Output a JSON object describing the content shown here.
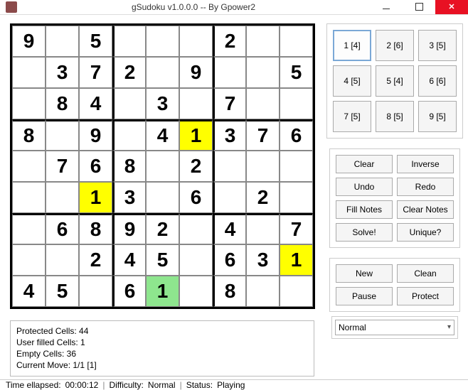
{
  "window": {
    "title": "gSudoku v1.0.0.0 -- By Gpower2"
  },
  "board": {
    "rows": [
      [
        "9",
        "",
        "5",
        "",
        "",
        "",
        "2",
        "",
        ""
      ],
      [
        "",
        "3",
        "7",
        "2",
        "",
        "9",
        "",
        "",
        "5"
      ],
      [
        "",
        "8",
        "4",
        "",
        "3",
        "",
        "7",
        "",
        ""
      ],
      [
        "8",
        "",
        "9",
        "",
        "4",
        "1",
        "3",
        "7",
        "6"
      ],
      [
        "",
        "7",
        "6",
        "8",
        "",
        "2",
        "",
        "",
        ""
      ],
      [
        "",
        "",
        "1",
        "3",
        "",
        "6",
        "",
        "2",
        ""
      ],
      [
        "",
        "6",
        "8",
        "9",
        "2",
        "",
        "4",
        "",
        "7"
      ],
      [
        "",
        "",
        "2",
        "4",
        "5",
        "",
        "6",
        "3",
        "1"
      ],
      [
        "4",
        "5",
        "",
        "6",
        "1",
        "",
        "8",
        "",
        ""
      ]
    ],
    "highlights": {
      "yellow": [
        [
          3,
          5
        ],
        [
          5,
          2
        ],
        [
          7,
          8
        ]
      ],
      "green": [
        [
          8,
          4
        ]
      ]
    }
  },
  "numpad": [
    {
      "label": "1 [4]",
      "selected": true
    },
    {
      "label": "2 [6]",
      "selected": false
    },
    {
      "label": "3 [5]",
      "selected": false
    },
    {
      "label": "4 [5]",
      "selected": false
    },
    {
      "label": "5 [4]",
      "selected": false
    },
    {
      "label": "6 [6]",
      "selected": false
    },
    {
      "label": "7 [5]",
      "selected": false
    },
    {
      "label": "8 [5]",
      "selected": false
    },
    {
      "label": "9 [5]",
      "selected": false
    }
  ],
  "actions1": [
    "Clear",
    "Inverse",
    "Undo",
    "Redo",
    "Fill Notes",
    "Clear Notes",
    "Solve!",
    "Unique?"
  ],
  "actions2": [
    "New",
    "Clean",
    "Pause",
    "Protect"
  ],
  "difficulty_select": "Normal",
  "info": {
    "protected": "Protected Cells: 44",
    "userfilled": "User filled Cells: 1",
    "empty": "Empty Cells: 36",
    "currentmove": "Current Move: 1/1 [1]"
  },
  "status": {
    "time_label": "Time ellapsed:",
    "time_value": "00:00:12",
    "diff_label": "Difficulty:",
    "diff_value": "Normal",
    "status_label": "Status:",
    "status_value": "Playing"
  }
}
